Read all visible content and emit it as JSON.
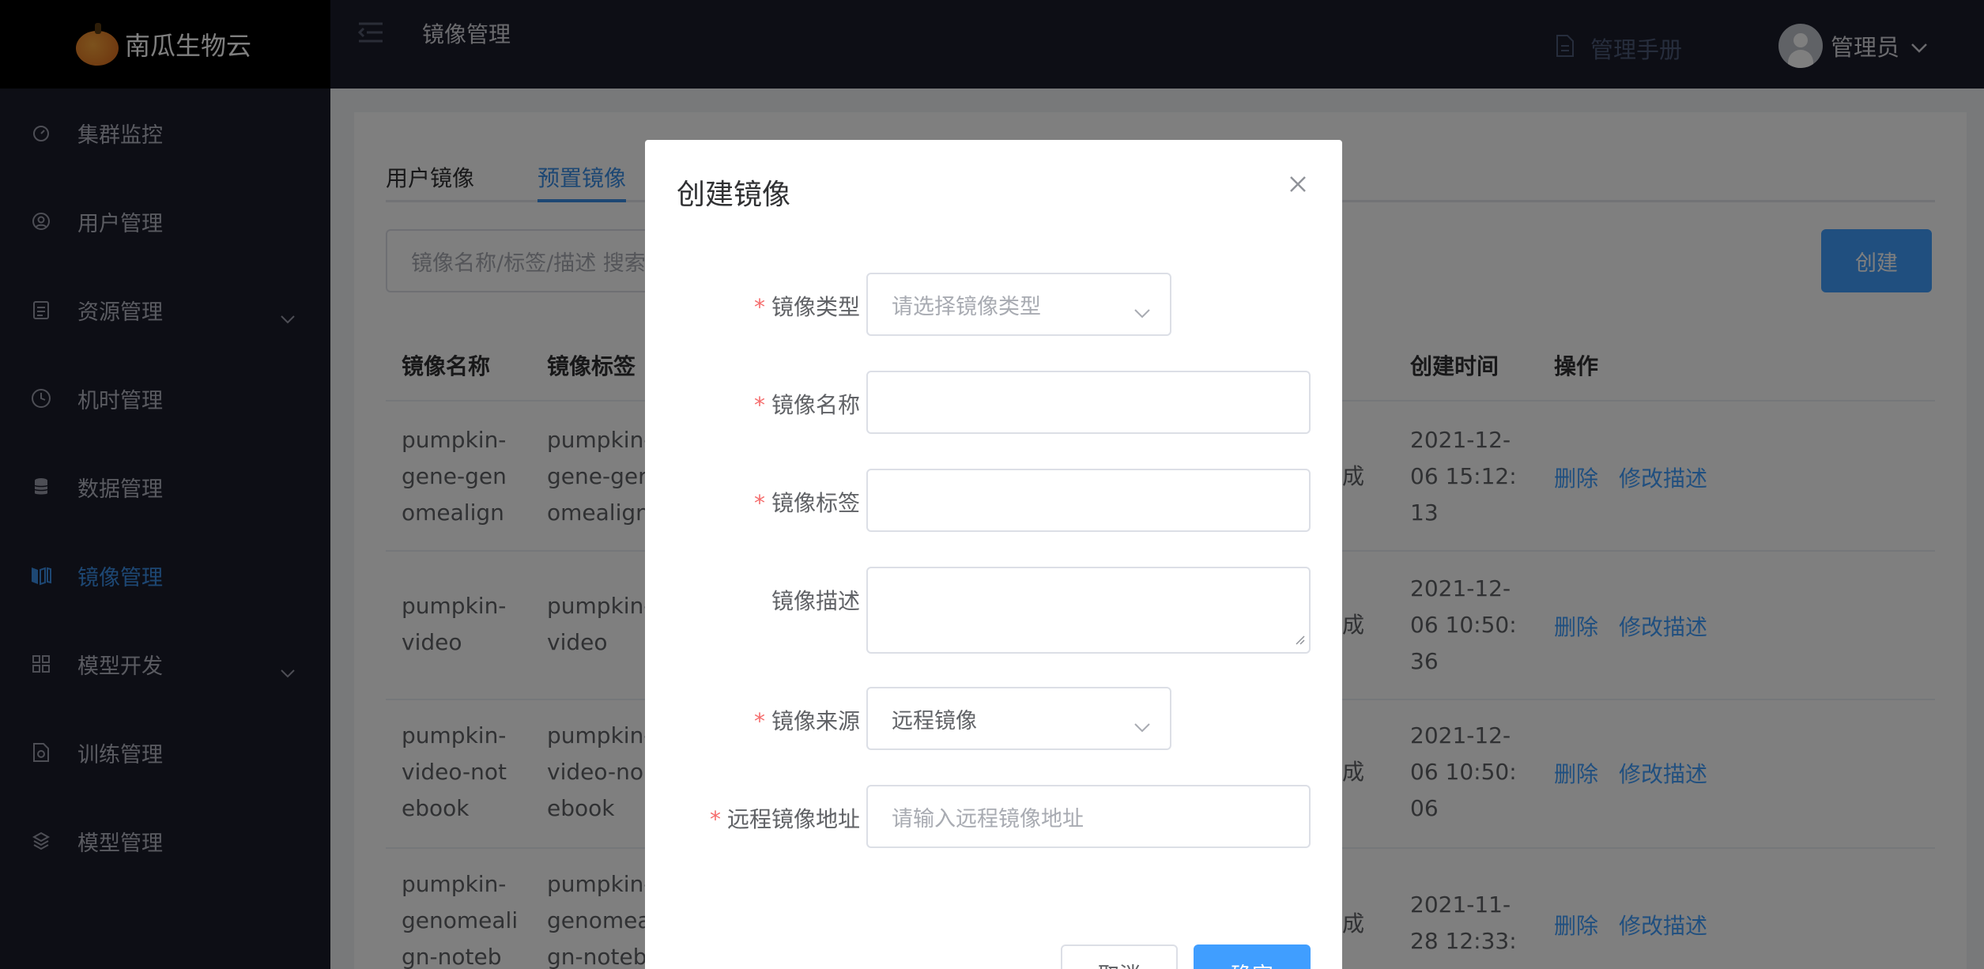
{
  "app": {
    "name": "南瓜生物云"
  },
  "sidebar": {
    "items": [
      {
        "label": "集群监控",
        "icon": "gauge-icon",
        "has_submenu": false,
        "active": false
      },
      {
        "label": "用户管理",
        "icon": "user-icon",
        "has_submenu": false,
        "active": false
      },
      {
        "label": "资源管理",
        "icon": "clipboard-icon",
        "has_submenu": true,
        "active": false
      },
      {
        "label": "机时管理",
        "icon": "clock-icon",
        "has_submenu": false,
        "active": false
      },
      {
        "label": "数据管理",
        "icon": "database-icon",
        "has_submenu": false,
        "active": false
      },
      {
        "label": "镜像管理",
        "icon": "image-layers-icon",
        "has_submenu": false,
        "active": true
      },
      {
        "label": "模型开发",
        "icon": "grid-icon",
        "has_submenu": true,
        "active": false
      },
      {
        "label": "训练管理",
        "icon": "training-doc-icon",
        "has_submenu": false,
        "active": false
      },
      {
        "label": "模型管理",
        "icon": "model-icon",
        "has_submenu": false,
        "active": false
      }
    ]
  },
  "header": {
    "page_title": "镜像管理",
    "manual_label": "管理手册",
    "user_name": "管理员"
  },
  "main": {
    "tabs": [
      {
        "label": "用户镜像",
        "active": false
      },
      {
        "label": "预置镜像",
        "active": true
      }
    ],
    "search_placeholder": "镜像名称/标签/描述 搜索",
    "create_label": "创建",
    "columns": [
      "镜像名称",
      "镜像标签",
      "创建时间",
      "操作"
    ],
    "rows": [
      {
        "name": [
          "pumpkin-",
          "gene-gen",
          "omealign"
        ],
        "tag": [
          "pumpkin-",
          "gene-ger",
          "omealign"
        ],
        "status_fragment": "成",
        "time": [
          "2021-12-",
          "06 15:12:",
          "13"
        ],
        "delete": "删除",
        "edit": "修改描述"
      },
      {
        "name": [
          "pumpkin-",
          "video"
        ],
        "tag": [
          "pumpkin-",
          "video"
        ],
        "status_fragment": "成",
        "time": [
          "2021-12-",
          "06 10:50:",
          "36"
        ],
        "delete": "删除",
        "edit": "修改描述"
      },
      {
        "name": [
          "pumpkin-",
          "video-not",
          "ebook"
        ],
        "tag": [
          "pumpkin-",
          "video-no",
          "ebook"
        ],
        "status_fragment": "成",
        "time": [
          "2021-12-",
          "06 10:50:",
          "06"
        ],
        "delete": "删除",
        "edit": "修改描述"
      },
      {
        "name": [
          "pumpkin-",
          "genomeali",
          "gn-noteb"
        ],
        "tag": [
          "pumpkin-",
          "genomea",
          "gn-noteb"
        ],
        "status_fragment": "成",
        "time": [
          "2021-11-",
          "28 12:33:"
        ],
        "delete": "删除",
        "edit": "修改描述"
      }
    ]
  },
  "modal": {
    "title": "创建镜像",
    "fields": {
      "type": {
        "label": "镜像类型",
        "required": true,
        "placeholder": "请选择镜像类型"
      },
      "name": {
        "label": "镜像名称",
        "required": true,
        "value": ""
      },
      "tag": {
        "label": "镜像标签",
        "required": true,
        "value": ""
      },
      "desc": {
        "label": "镜像描述",
        "required": false,
        "value": ""
      },
      "source": {
        "label": "镜像来源",
        "required": true,
        "value": "远程镜像"
      },
      "remote_url": {
        "label": "远程镜像地址",
        "required": true,
        "placeholder": "请输入远程镜像地址"
      }
    },
    "cancel_label": "取消",
    "confirm_label": "确定"
  },
  "colors": {
    "accent": "#409eff",
    "sidebar_bg": "#1b1c2b",
    "required": "#f56c6c"
  }
}
